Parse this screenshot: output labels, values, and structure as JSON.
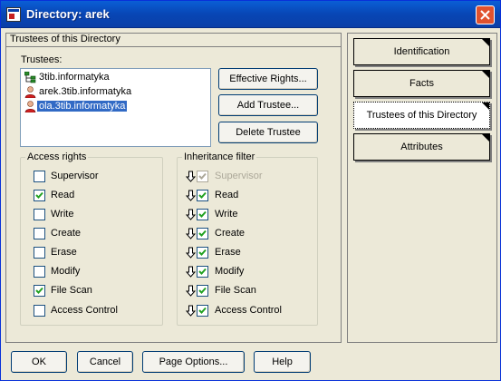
{
  "window": {
    "title": "Directory: arek"
  },
  "panel": {
    "title": "Trustees of this Directory"
  },
  "trustees": {
    "label": "Trustees:",
    "items": [
      {
        "name": "3tib.informatyka",
        "icon": "org-tree-icon",
        "selected": false
      },
      {
        "name": "arek.3tib.informatyka",
        "icon": "user-icon",
        "selected": false
      },
      {
        "name": "ola.3tib.informatyka",
        "icon": "user-icon",
        "selected": true
      }
    ]
  },
  "buttons": {
    "effective_rights": "Effective Rights...",
    "add_trustee": "Add Trustee...",
    "delete_trustee": "Delete Trustee"
  },
  "access_rights": {
    "title": "Access rights",
    "items": [
      {
        "label": "Supervisor",
        "checked": false
      },
      {
        "label": "Read",
        "checked": true
      },
      {
        "label": "Write",
        "checked": false
      },
      {
        "label": "Create",
        "checked": false
      },
      {
        "label": "Erase",
        "checked": false
      },
      {
        "label": "Modify",
        "checked": false
      },
      {
        "label": "File Scan",
        "checked": true
      },
      {
        "label": "Access Control",
        "checked": false
      }
    ]
  },
  "inheritance_filter": {
    "title": "Inheritance filter",
    "items": [
      {
        "label": "Supervisor",
        "checked": true,
        "disabled": true
      },
      {
        "label": "Read",
        "checked": true,
        "disabled": false
      },
      {
        "label": "Write",
        "checked": true,
        "disabled": false
      },
      {
        "label": "Create",
        "checked": true,
        "disabled": false
      },
      {
        "label": "Erase",
        "checked": true,
        "disabled": false
      },
      {
        "label": "Modify",
        "checked": true,
        "disabled": false
      },
      {
        "label": "File Scan",
        "checked": true,
        "disabled": false
      },
      {
        "label": "Access Control",
        "checked": true,
        "disabled": false
      }
    ]
  },
  "tabs": [
    {
      "label": "Identification",
      "active": false
    },
    {
      "label": "Facts",
      "active": false
    },
    {
      "label": "Trustees of this Directory",
      "active": true
    },
    {
      "label": "Attributes",
      "active": false
    }
  ],
  "footer": {
    "ok": "OK",
    "cancel": "Cancel",
    "page_options": "Page Options...",
    "help": "Help"
  },
  "colors": {
    "title_bar": "#0846b5",
    "selection": "#316ac5",
    "close_button": "#e0522e"
  }
}
